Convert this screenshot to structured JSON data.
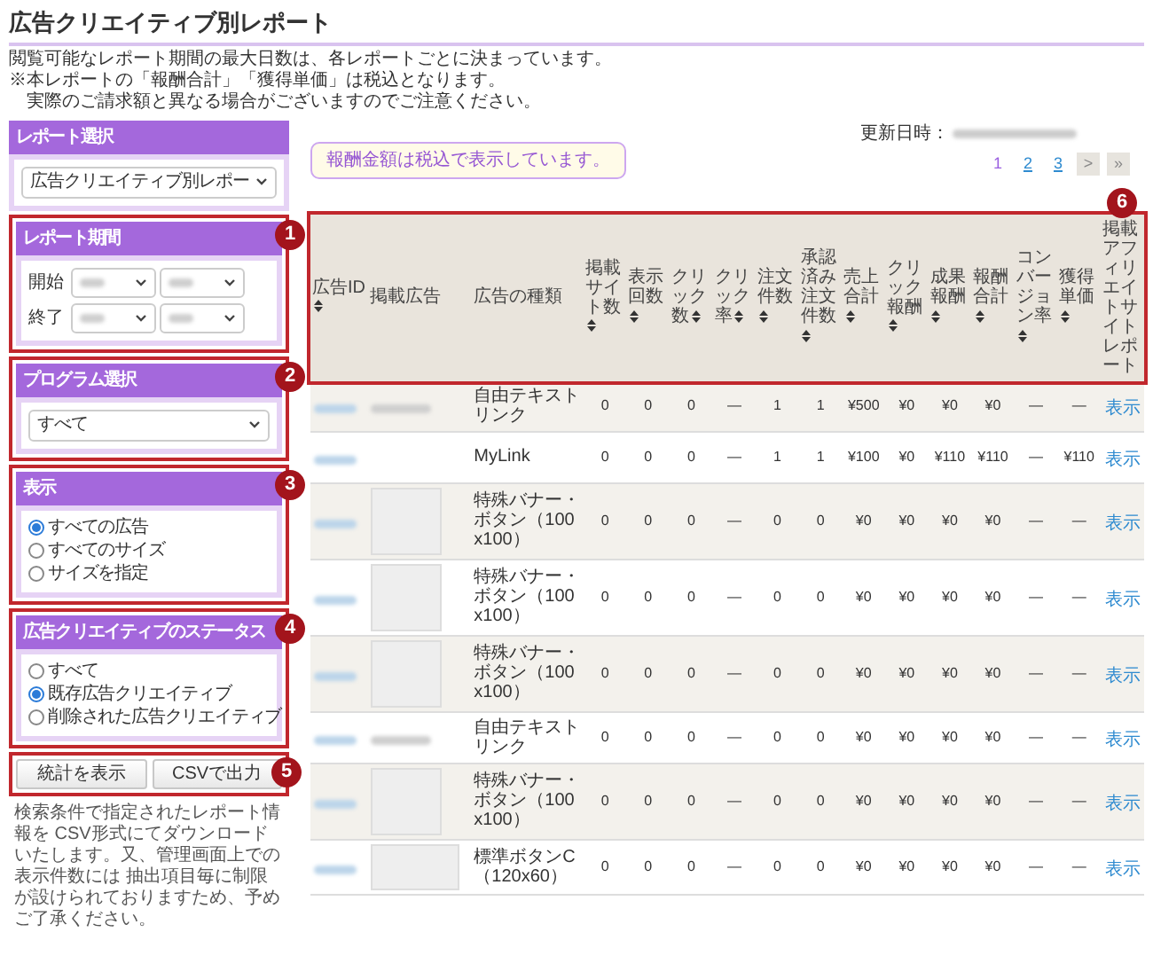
{
  "title": "広告クリエイティブ別レポート",
  "notes": [
    "閲覧可能なレポート期間の最大日数は、各レポートごとに決まっています。",
    "※本レポートの「報酬合計」「獲得単価」は税込となります。",
    "実際のご請求額と異なる場合がございますのでご注意ください。"
  ],
  "sidebar": {
    "panels": [
      {
        "kind": "select",
        "title": "レポート選択",
        "value": "広告クリエイティブ別レポー"
      },
      {
        "kind": "period",
        "title": "レポート期間",
        "marker": "1",
        "rows": [
          {
            "label": "開始"
          },
          {
            "label": "終了"
          }
        ]
      },
      {
        "kind": "select",
        "title": "プログラム選択",
        "marker": "2",
        "value": "すべて"
      },
      {
        "kind": "radio",
        "title": "表示",
        "marker": "3",
        "options": [
          {
            "label": "すべての広告",
            "selected": true
          },
          {
            "label": "すべてのサイズ",
            "selected": false
          },
          {
            "label": "サイズを指定",
            "selected": false
          }
        ]
      },
      {
        "kind": "radio",
        "title": "広告クリエイティブのステータス",
        "marker": "4",
        "options": [
          {
            "label": "すべて",
            "selected": false
          },
          {
            "label": "既存広告クリエイティブ",
            "selected": true
          },
          {
            "label": "削除された広告クリエイティブ",
            "selected": false
          }
        ]
      }
    ],
    "buttons_marker": "5",
    "buttons": [
      "統計を表示",
      "CSVで出力"
    ],
    "description": "検索条件で指定されたレポート情報を CSV形式にてダウンロードいたします。又、管理画面上での表示件数には 抽出項目毎に制限が設けられておりますため、予めご了承ください。"
  },
  "notice": "報酬金額は税込で表示しています。",
  "updated_label": "更新日時：",
  "pagination": [
    {
      "label": "1",
      "selected": true
    },
    {
      "label": "2",
      "selected": false
    },
    {
      "label": "3",
      "selected": false
    }
  ],
  "pagination_nav": [
    ">",
    "»"
  ],
  "table": {
    "marker": "6",
    "columns": [
      {
        "label": "広告ID",
        "sortable": true
      },
      {
        "label": "掲載広告",
        "sortable": false
      },
      {
        "label": "広告の種類",
        "sortable": false
      },
      {
        "label": "掲載サイト数",
        "sortable": true
      },
      {
        "label": "表示回数",
        "sortable": true
      },
      {
        "label": "クリック数",
        "sortable": true
      },
      {
        "label": "クリック率",
        "sortable": true
      },
      {
        "label": "注文件数",
        "sortable": true
      },
      {
        "label": "承認済み注文件数",
        "sortable": true
      },
      {
        "label": "売上合計",
        "sortable": true
      },
      {
        "label": "クリック報酬",
        "sortable": true
      },
      {
        "label": "成果報酬",
        "sortable": true
      },
      {
        "label": "報酬合計",
        "sortable": true
      },
      {
        "label": "コンバージョン率",
        "sortable": true
      },
      {
        "label": "獲得単価",
        "sortable": true
      },
      {
        "label": "掲載アフィリエイトサイトレポート",
        "sortable": false
      }
    ],
    "rows": [
      {
        "kind": "text",
        "ad_type": "自由テキストリンク",
        "values": [
          "0",
          "0",
          "0",
          "—",
          "1",
          "1",
          "¥500",
          "¥0",
          "¥0",
          "¥0",
          "—",
          "—"
        ],
        "link": "表示"
      },
      {
        "kind": "none",
        "ad_type": "MyLink",
        "values": [
          "0",
          "0",
          "0",
          "—",
          "1",
          "1",
          "¥100",
          "¥0",
          "¥110",
          "¥110",
          "—",
          "¥110"
        ],
        "link": "表示"
      },
      {
        "kind": "square",
        "ad_type": "特殊バナー・ボタン（100x100）",
        "values": [
          "0",
          "0",
          "0",
          "—",
          "0",
          "0",
          "¥0",
          "¥0",
          "¥0",
          "¥0",
          "—",
          "—"
        ],
        "link": "表示"
      },
      {
        "kind": "square",
        "ad_type": "特殊バナー・ボタン（100x100）",
        "values": [
          "0",
          "0",
          "0",
          "—",
          "0",
          "0",
          "¥0",
          "¥0",
          "¥0",
          "¥0",
          "—",
          "—"
        ],
        "link": "表示"
      },
      {
        "kind": "square",
        "ad_type": "特殊バナー・ボタン（100x100）",
        "values": [
          "0",
          "0",
          "0",
          "—",
          "0",
          "0",
          "¥0",
          "¥0",
          "¥0",
          "¥0",
          "—",
          "—"
        ],
        "link": "表示"
      },
      {
        "kind": "text",
        "ad_type": "自由テキストリンク",
        "values": [
          "0",
          "0",
          "0",
          "—",
          "0",
          "0",
          "¥0",
          "¥0",
          "¥0",
          "¥0",
          "—",
          "—"
        ],
        "link": "表示"
      },
      {
        "kind": "square",
        "ad_type": "特殊バナー・ボタン（100x100）",
        "values": [
          "0",
          "0",
          "0",
          "—",
          "0",
          "0",
          "¥0",
          "¥0",
          "¥0",
          "¥0",
          "—",
          "—"
        ],
        "link": "表示"
      },
      {
        "kind": "wide",
        "ad_type": "標準ボタンC（120x60）",
        "values": [
          "0",
          "0",
          "0",
          "—",
          "0",
          "0",
          "¥0",
          "¥0",
          "¥0",
          "¥0",
          "—",
          "—"
        ],
        "link": "表示"
      }
    ]
  }
}
